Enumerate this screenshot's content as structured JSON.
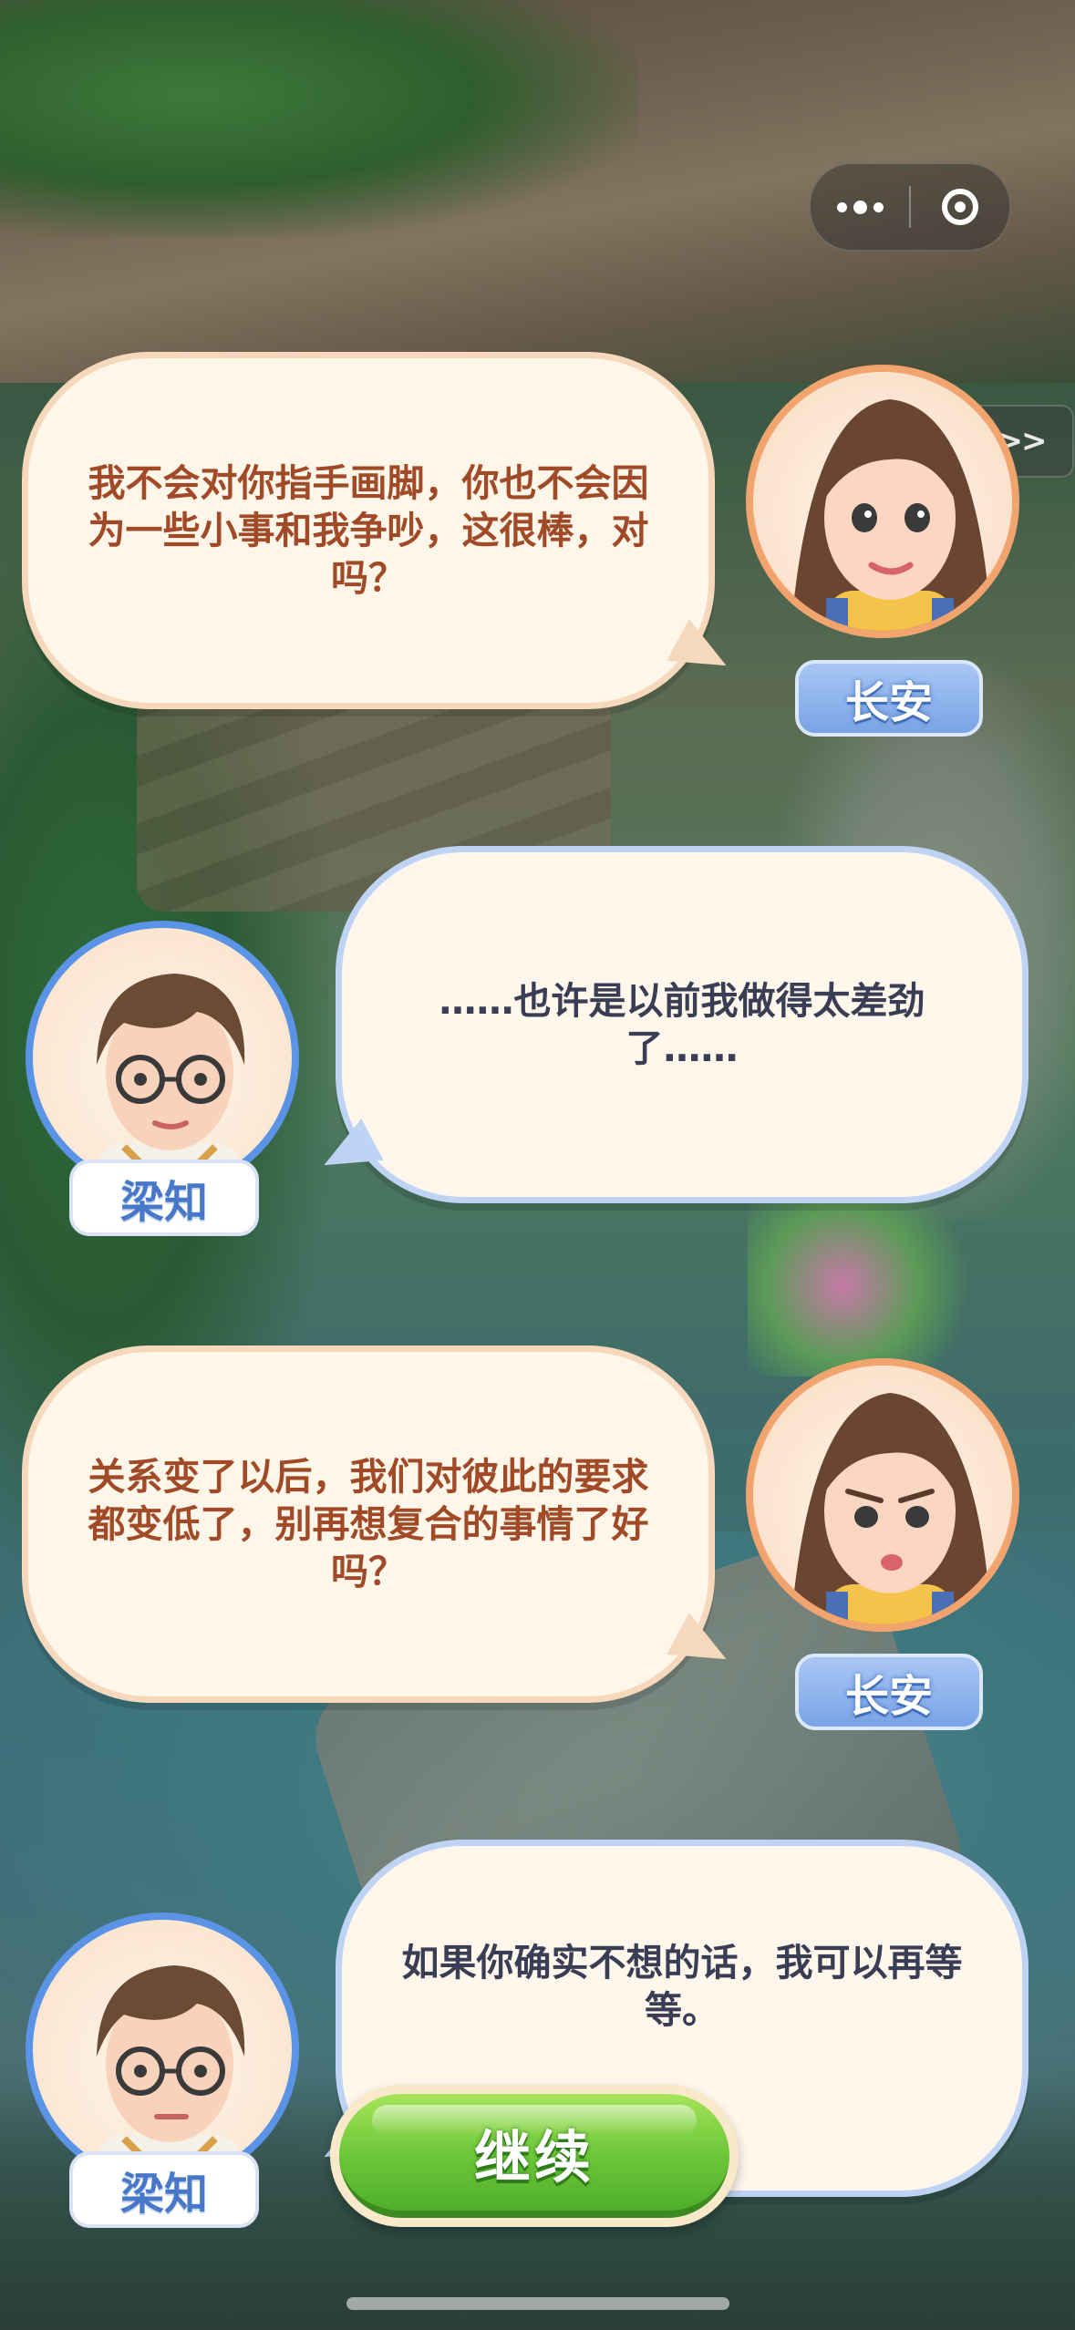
{
  "capsule": {
    "more_icon": "more-dots-icon",
    "close_icon": "target-circle-icon"
  },
  "skip": {
    "label": ">>"
  },
  "dialogue": [
    {
      "speaker": "长安",
      "text": "我不会对你指手画脚，你也不会因为一些小事和我争吵，这很棒，对吗？"
    },
    {
      "speaker": "梁知",
      "text": "……也许是以前我做得太差劲了……"
    },
    {
      "speaker": "长安",
      "text": "关系变了以后，我们对彼此的要求都变低了，别再想复合的事情了好吗？"
    },
    {
      "speaker": "梁知",
      "text": "如果你确实不想的话，我可以再等等。"
    }
  ],
  "continue_button": {
    "label": "继续"
  },
  "colors": {
    "changan_border": "#f6d9bd",
    "changan_text": "#a04a28",
    "liangzhi_border": "#bfd4f4",
    "liangzhi_text": "#3a3e55",
    "continue_green": "#6fc83a"
  }
}
